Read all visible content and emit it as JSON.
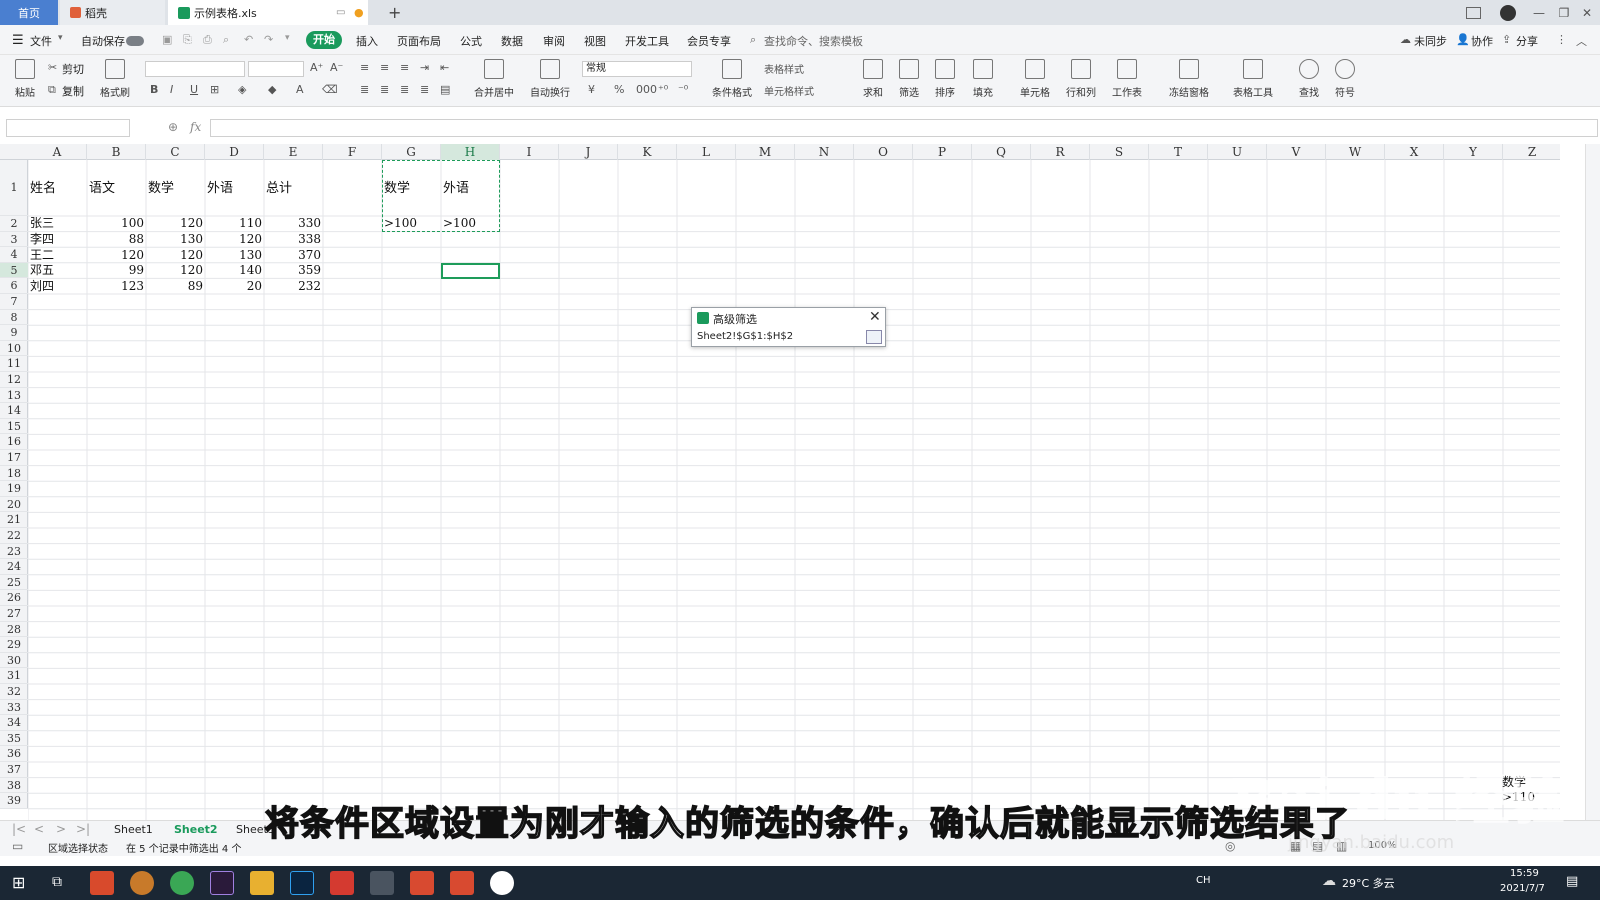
{
  "tabs": {
    "home": "首页",
    "daoke": "稻壳",
    "file": "示例表格.xls",
    "new_tab": "+"
  },
  "menu": {
    "file": "文件",
    "autosave": "自动保存",
    "start": "开始",
    "items": [
      "插入",
      "页面布局",
      "公式",
      "数据",
      "审阅",
      "视图",
      "开发工具",
      "会员专享"
    ],
    "search": "查找命令、搜索模板",
    "sync": "未同步",
    "collab": "协作",
    "share": "分享"
  },
  "ribbon": {
    "cut": "剪切",
    "paste": "粘贴",
    "copy": "复制",
    "format_painter": "格式刷",
    "merge": "合并居中",
    "wrap": "自动换行",
    "number_format": "常规",
    "cond_format": "条件格式",
    "table_style": "表格样式",
    "cell_style": "单元格样式",
    "sum": "求和",
    "filter": "筛选",
    "sort": "排序",
    "fill": "填充",
    "cell": "单元格",
    "rowcol": "行和列",
    "sheet": "工作表",
    "freeze": "冻结窗格",
    "table_tools": "表格工具",
    "find": "查找",
    "symbol": "符号"
  },
  "formula": {
    "fx": "fx"
  },
  "grid": {
    "columns": [
      "A",
      "B",
      "C",
      "D",
      "E",
      "F",
      "G",
      "H",
      "I",
      "J",
      "K",
      "L",
      "M",
      "N",
      "O",
      "P",
      "Q",
      "R",
      "S",
      "T",
      "U",
      "V",
      "W",
      "X",
      "Y",
      "Z"
    ],
    "rows": [
      "1",
      "2",
      "3",
      "4",
      "5",
      "6",
      "7",
      "8",
      "9",
      "10",
      "11",
      "12",
      "13",
      "14",
      "15",
      "16",
      "17",
      "18",
      "19",
      "20",
      "21",
      "22",
      "23",
      "24",
      "25",
      "26",
      "27",
      "28",
      "29",
      "30",
      "31",
      "32",
      "33",
      "34",
      "35",
      "36",
      "37",
      "38",
      "39"
    ],
    "header": [
      "姓名",
      "语文",
      "数学",
      "外语",
      "总计"
    ],
    "data": [
      [
        "张三",
        "100",
        "120",
        "110",
        "330"
      ],
      [
        "李四",
        "88",
        "130",
        "120",
        "338"
      ],
      [
        "王二",
        "120",
        "120",
        "130",
        "370"
      ],
      [
        "邓五",
        "99",
        "120",
        "140",
        "359"
      ],
      [
        "刘四",
        "123",
        "89",
        "20",
        "232"
      ]
    ],
    "criteria_headers": [
      "数学",
      "外语"
    ],
    "criteria_values": [
      ">100",
      ">100"
    ],
    "corner_label": "数学",
    "corner_value": ">110"
  },
  "dialog": {
    "title": "高级筛选",
    "value": "Sheet2!$G$1:$H$2"
  },
  "sheets": [
    "Sheet1",
    "Sheet2",
    "Sheet3"
  ],
  "status": {
    "mode": "区域选择状态",
    "info": "在 5 个记录中筛选出 4 个",
    "zoom": "100%"
  },
  "taskbar": {
    "lang": "CH",
    "weather": "29°C 多云",
    "time": "15:59",
    "date": "2021/7/7"
  },
  "subtitle": "将条件区域设置为刚才输入的筛选的条件，确认后就能显示筛选结果了",
  "watermark": {
    "logo": "Bai du 经验",
    "url": "jingyan.baidu.com"
  },
  "colors": {
    "accent": "#1a9a5c",
    "selection": "#1e9c5a",
    "taskbar": "#1b2734",
    "tab_active": "#4a7fd0"
  }
}
